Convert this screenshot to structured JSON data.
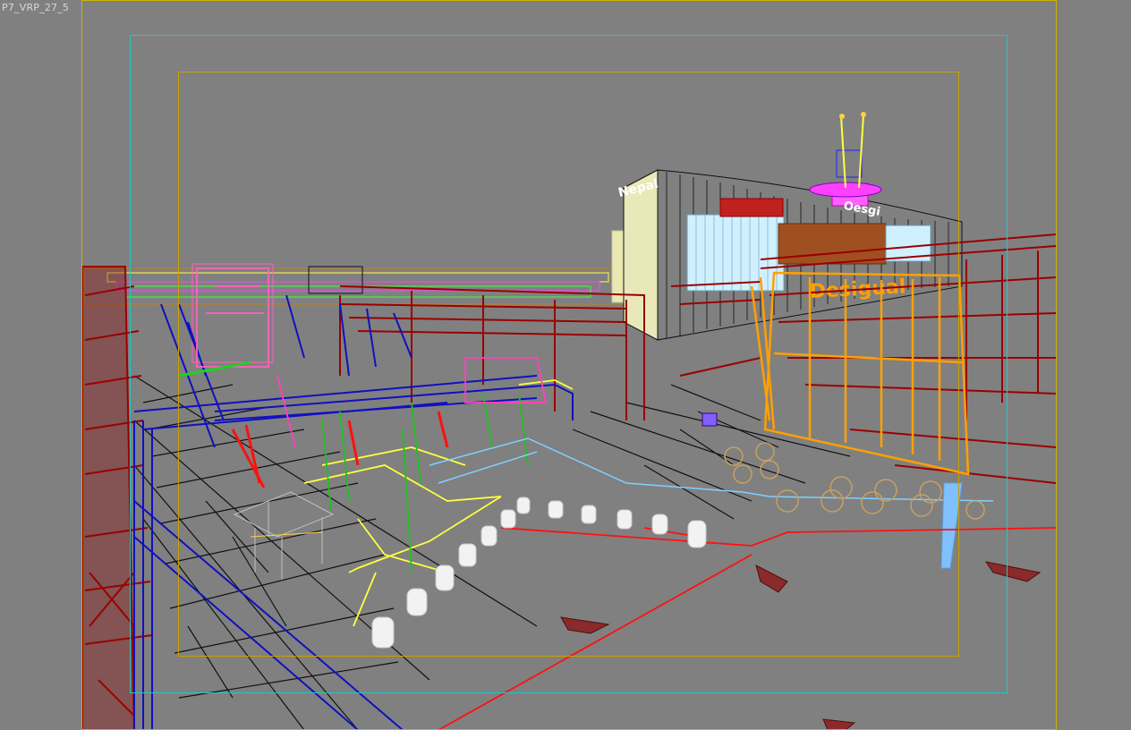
{
  "viewport": {
    "label": "P7_VRP_27_5",
    "background": "#808080",
    "safe_frame_colors": {
      "outer": "#c8b400",
      "action": "#20c8c8",
      "title": "#c8a000"
    }
  },
  "scene": {
    "signs": {
      "left_tower": "Nepal",
      "center": "Desigual",
      "right_tower": "Oesgi"
    },
    "wire_colors": {
      "structure": "#9a0000",
      "blue": "#1010c0",
      "yellow": "#ffff40",
      "orange": "#ffa000",
      "green": "#20c020",
      "magenta": "#ff40c0",
      "cyan": "#80d0ff",
      "black": "#101010",
      "red": "#ff1010"
    }
  }
}
